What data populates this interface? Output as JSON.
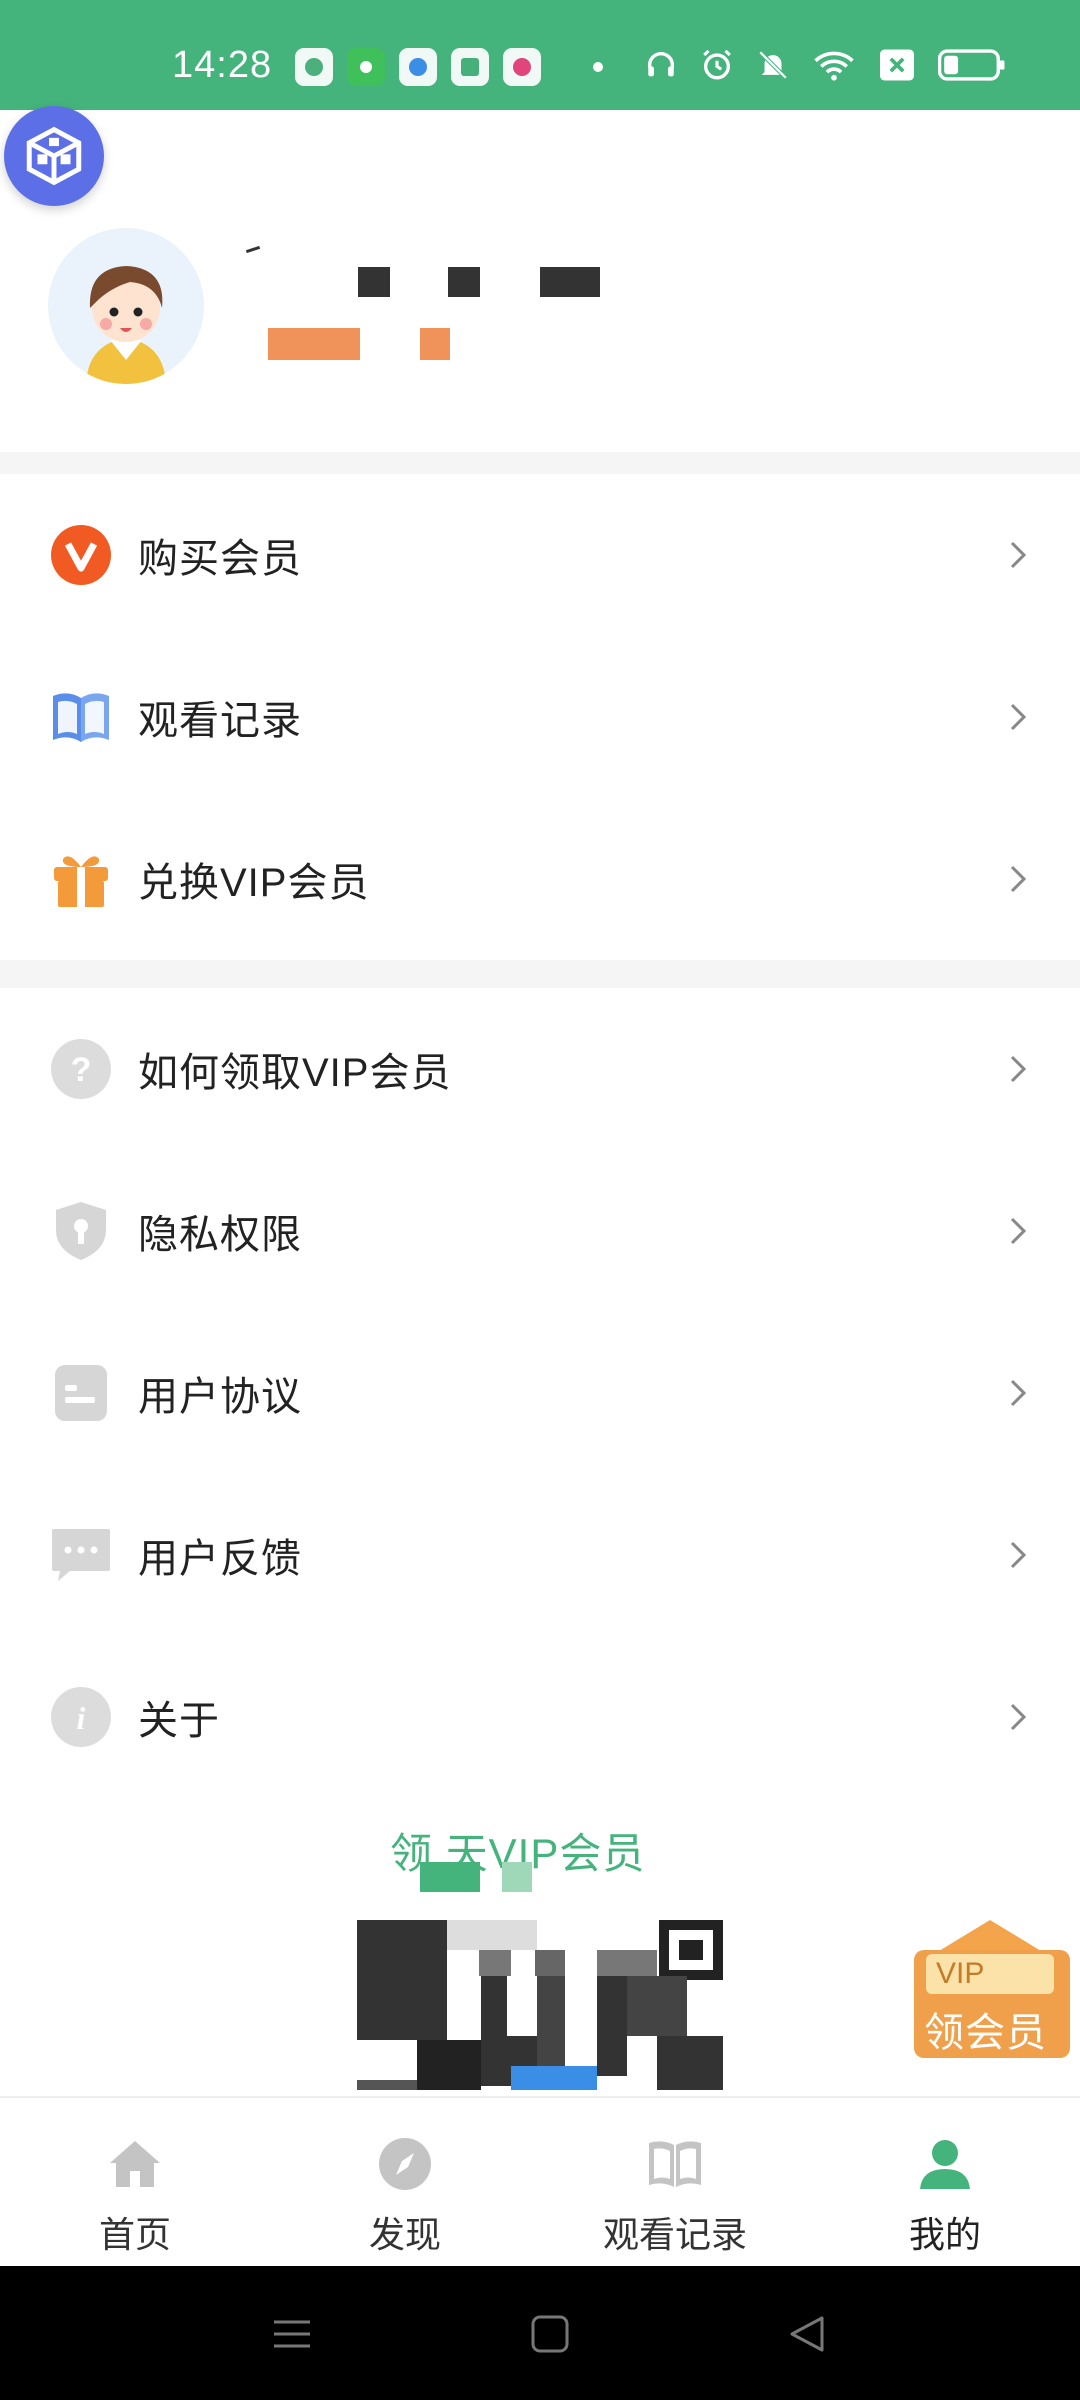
{
  "status_bar": {
    "time": "14:28",
    "bg_color": "#45b37c",
    "apps": [
      "k-app-icon",
      "green-app-icon",
      "browser-app-icon",
      "shield-app-icon",
      "baidu-app-icon"
    ],
    "right_icons": [
      "headphones-icon",
      "alarm-icon",
      "mute-icon",
      "wifi-icon",
      "sim-off-icon",
      "battery-icon"
    ]
  },
  "profile": {
    "nickname_hidden": true
  },
  "menu": {
    "group1": [
      {
        "label": "购买会员",
        "icon": "vip-v-icon"
      },
      {
        "label": "观看记录",
        "icon": "book-icon"
      },
      {
        "label": "兑换VIP会员",
        "icon": "gift-icon"
      }
    ],
    "group2": [
      {
        "label": "如何领取VIP会员",
        "icon": "question-icon"
      },
      {
        "label": "隐私权限",
        "icon": "privacy-shield-icon"
      },
      {
        "label": "用户协议",
        "icon": "agreement-icon"
      },
      {
        "label": "用户反馈",
        "icon": "feedback-icon"
      },
      {
        "label": "关于",
        "icon": "info-icon"
      }
    ]
  },
  "promo": {
    "title": "领   天VIP会员",
    "accent": "#45b37c"
  },
  "vip_badge": {
    "top": "VIP",
    "text": "领会员"
  },
  "bottom_nav": {
    "items": [
      {
        "label": "首页",
        "icon": "home-icon",
        "active": false
      },
      {
        "label": "发现",
        "icon": "compass-icon",
        "active": false
      },
      {
        "label": "观看记录",
        "icon": "book-icon",
        "active": false
      },
      {
        "label": "我的",
        "icon": "user-icon",
        "active": true
      }
    ],
    "active_color": "#45b37c"
  },
  "system_nav": [
    "menu-icon",
    "home-square-icon",
    "back-triangle-icon"
  ]
}
